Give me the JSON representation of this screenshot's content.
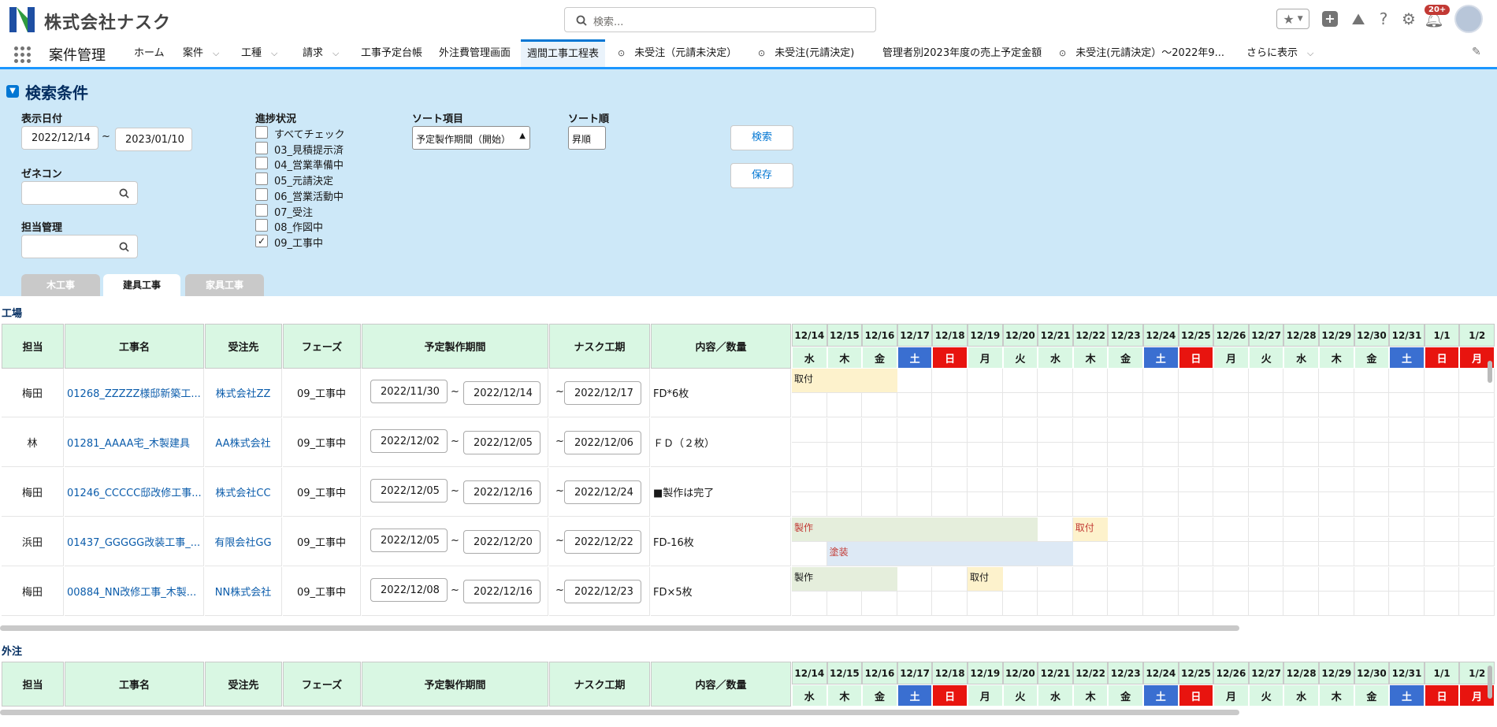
{
  "header": {
    "brand": "株式会社ナスク",
    "search_placeholder": "検索...",
    "notif_badge": "20+"
  },
  "nav": {
    "app_name": "案件管理",
    "items": [
      {
        "label": "ホーム",
        "chevron": false
      },
      {
        "label": "案件",
        "chevron": true
      },
      {
        "label": "工種",
        "chevron": true
      },
      {
        "label": "請求",
        "chevron": true
      },
      {
        "label": "工事予定台帳",
        "chevron": false
      },
      {
        "label": "外注費管理画面",
        "chevron": false
      },
      {
        "label": "週間工事工程表",
        "chevron": false,
        "active": true
      },
      {
        "label": "未受注（元請未決定）",
        "chevron": false,
        "icon": true
      },
      {
        "label": "未受注(元請決定)",
        "chevron": false,
        "icon": true
      },
      {
        "label": "管理者別2023年度の売上予定金額",
        "chevron": false
      },
      {
        "label": "未受注(元請決定）〜2022年9...",
        "chevron": false,
        "icon": true
      },
      {
        "label": "さらに表示",
        "chevron": true
      }
    ]
  },
  "panel": {
    "title": "検索条件",
    "date_label": "表示日付",
    "date_from": "2022/12/14",
    "date_sep": "~",
    "date_to": "2023/01/10",
    "zenecon_label": "ゼネコン",
    "manager_label": "担当管理",
    "progress_label": "進捗状況",
    "progress": [
      {
        "label": "すべてチェック",
        "checked": false
      },
      {
        "label": "03_見積提示済",
        "checked": false
      },
      {
        "label": "04_営業準備中",
        "checked": false
      },
      {
        "label": "05_元請決定",
        "checked": false
      },
      {
        "label": "06_営業活動中",
        "checked": false
      },
      {
        "label": "07_受注",
        "checked": false
      },
      {
        "label": "08_作図中",
        "checked": false
      },
      {
        "label": "09_工事中",
        "checked": true
      }
    ],
    "sort_label": "ソート項目",
    "sort_value": "予定製作期間（開始）",
    "order_label": "ソート順",
    "order_value": "昇順",
    "search_btn": "検索",
    "save_btn": "保存",
    "tabs": [
      {
        "label": "木工事",
        "active": false
      },
      {
        "label": "建具工事",
        "active": true
      },
      {
        "label": "家具工事",
        "active": false
      }
    ]
  },
  "factory": {
    "section": "工場"
  },
  "outsource": {
    "section": "外注"
  },
  "columns": {
    "tanto": "担当",
    "name": "工事名",
    "client": "受注先",
    "phase": "フェーズ",
    "period": "予定製作期間",
    "nask": "ナスク工期",
    "content": "内容／数量"
  },
  "days": [
    {
      "date": "12/14",
      "dow": "水",
      "type": "wd"
    },
    {
      "date": "12/15",
      "dow": "木",
      "type": "wd"
    },
    {
      "date": "12/16",
      "dow": "金",
      "type": "wd"
    },
    {
      "date": "12/17",
      "dow": "土",
      "type": "sat"
    },
    {
      "date": "12/18",
      "dow": "日",
      "type": "sun"
    },
    {
      "date": "12/19",
      "dow": "月",
      "type": "wd"
    },
    {
      "date": "12/20",
      "dow": "火",
      "type": "wd"
    },
    {
      "date": "12/21",
      "dow": "水",
      "type": "wd"
    },
    {
      "date": "12/22",
      "dow": "木",
      "type": "wd"
    },
    {
      "date": "12/23",
      "dow": "金",
      "type": "wd"
    },
    {
      "date": "12/24",
      "dow": "土",
      "type": "sat"
    },
    {
      "date": "12/25",
      "dow": "日",
      "type": "sun"
    },
    {
      "date": "12/26",
      "dow": "月",
      "type": "wd"
    },
    {
      "date": "12/27",
      "dow": "火",
      "type": "wd"
    },
    {
      "date": "12/28",
      "dow": "水",
      "type": "wd"
    },
    {
      "date": "12/29",
      "dow": "木",
      "type": "wd"
    },
    {
      "date": "12/30",
      "dow": "金",
      "type": "wd"
    },
    {
      "date": "12/31",
      "dow": "土",
      "type": "sat"
    },
    {
      "date": "1/1",
      "dow": "日",
      "type": "sun"
    },
    {
      "date": "1/2",
      "dow": "月",
      "type": "sun"
    }
  ],
  "rows": [
    {
      "tanto": "梅田",
      "name": "01268_ZZZZZ様邸新築工...",
      "client": "株式会社ZZ",
      "phase": "09_工事中",
      "start": "2022/11/30",
      "end": "2022/12/14",
      "nask": "2022/12/17",
      "content": "FD*6枚",
      "bars": [
        {
          "lane": 0,
          "from": 0,
          "to": 3,
          "label": "取付",
          "color": "#fdf2cc",
          "text": "#181818"
        }
      ]
    },
    {
      "tanto": "林",
      "name": "01281_AAAA宅_木製建具",
      "client": "AA株式会社",
      "phase": "09_工事中",
      "start": "2022/12/02",
      "end": "2022/12/05",
      "nask": "2022/12/06",
      "content": "ＦＤ（２枚）",
      "bars": []
    },
    {
      "tanto": "梅田",
      "name": "01246_CCCCC邸改修工事...",
      "client": "株式会社CC",
      "phase": "09_工事中",
      "start": "2022/12/05",
      "end": "2022/12/16",
      "nask": "2022/12/24",
      "content": "■製作は完了",
      "bars": []
    },
    {
      "tanto": "浜田",
      "name": "01437_GGGGG改装工事_...",
      "client": "有限会社GG",
      "phase": "09_工事中",
      "start": "2022/12/05",
      "end": "2022/12/20",
      "nask": "2022/12/22",
      "content": "FD-16枚",
      "bars": [
        {
          "lane": 0,
          "from": 0,
          "to": 7,
          "label": "製作",
          "color": "#e5eedc",
          "text": "#c23934"
        },
        {
          "lane": 0,
          "from": 8,
          "to": 9,
          "label": "取付",
          "color": "#fdf2cc",
          "text": "#c23934"
        },
        {
          "lane": 1,
          "from": 1,
          "to": 8,
          "label": "塗装",
          "color": "#dde9f5",
          "text": "#c23934"
        }
      ]
    },
    {
      "tanto": "梅田",
      "name": "00884_NN改修工事_木製...",
      "client": "NN株式会社",
      "phase": "09_工事中",
      "start": "2022/12/08",
      "end": "2022/12/16",
      "nask": "2022/12/23",
      "content": "FD×5枚",
      "bars": [
        {
          "lane": 0,
          "from": 0,
          "to": 3,
          "label": "製作",
          "color": "#e5eedc",
          "text": "#181818"
        },
        {
          "lane": 0,
          "from": 5,
          "to": 6,
          "label": "取付",
          "color": "#fdf2cc",
          "text": "#181818"
        }
      ]
    }
  ],
  "colors": {
    "sat": "#3a6fd1",
    "sun": "#e8140f",
    "accent": "#0176d3",
    "header_green": "#d9f7e3",
    "panel": "#cde8f8"
  }
}
